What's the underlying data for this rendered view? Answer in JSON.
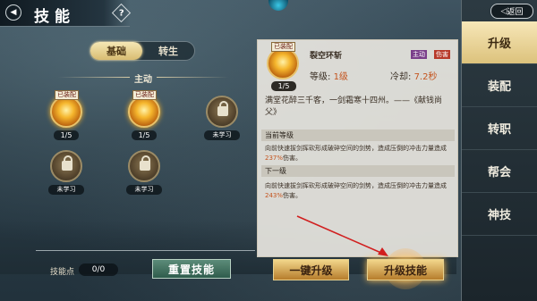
{
  "header": {
    "title": "技能",
    "help": "?"
  },
  "tabs": [
    {
      "label": "基础"
    },
    {
      "label": "转生"
    }
  ],
  "section": {
    "title": "主动"
  },
  "skills": [
    {
      "tag": "已装配",
      "level": "1/5"
    },
    {
      "tag": "已装配",
      "level": "1/5"
    },
    {
      "status": "未学习"
    },
    {
      "status": "未学习"
    },
    {
      "status": "未学习"
    }
  ],
  "footer": {
    "points_label": "技能点",
    "points_value": "0/0",
    "reset_label": "重置技能"
  },
  "detail": {
    "equip_tag": "已装配",
    "name": "裂空环斩",
    "tag_active": "主动",
    "tag_damage": "伤害",
    "level_label": "等级:",
    "level_value": "1级",
    "cooldown_label": "冷却:",
    "cooldown_value": "7.2秒",
    "icon_level": "1/5",
    "quote": "满堂花醉三千客，一剑霜寒十四州。——《献钱尚父》",
    "current_title": "当前等级",
    "current_text_a": "向前快速拔剑挥砍形成破碎空间的剑势，造成压倒的冲击力量造成",
    "current_pct": "237%",
    "current_text_b": "伤害。",
    "next_title": "下一级",
    "next_text_a": "向前快速拔剑挥砍形成破碎空间的剑势，造成压倒的冲击力量造成",
    "next_pct": "243%",
    "next_text_b": "伤害。"
  },
  "actions": {
    "one_key": "一键升级",
    "upgrade": "升级技能"
  },
  "sidebar": {
    "return": "返回",
    "items": [
      {
        "label": "升级"
      },
      {
        "label": "装配"
      },
      {
        "label": "转职"
      },
      {
        "label": "帮会"
      },
      {
        "label": "神技"
      }
    ]
  },
  "colors": {
    "accent": "#dcc27c",
    "highlight": "#c4541e",
    "reset": "#2f5c4c"
  }
}
